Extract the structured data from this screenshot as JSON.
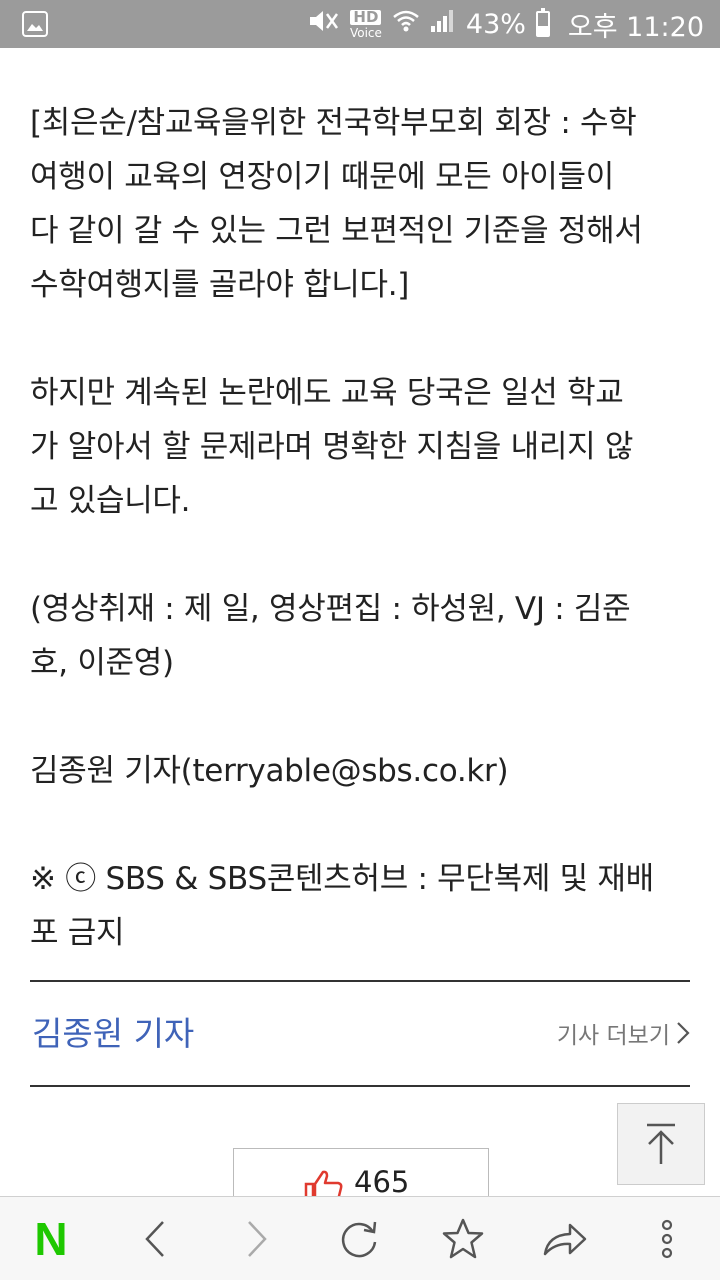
{
  "status_bar": {
    "hd_label": "HD",
    "voice_label": "Voice",
    "battery_percent": "43%",
    "battery_level": 0.43,
    "time": "오후 11:20"
  },
  "article": {
    "paragraphs": [
      "[최은순/참교육을위한 전국학부모회 회장 : 수학\n여행이 교육의 연장이기 때문에 모든 아이들이\n다 같이 갈 수 있는 그런 보편적인 기준을 정해서\n수학여행지를 골라야 합니다.]",
      "하지만 계속된 논란에도 교육 당국은 일선 학교\n가 알아서 할 문제라며 명확한 지침을 내리지 않\n고 있습니다.",
      "(영상취재 : 제 일, 영상편집 : 하성원, VJ : 김준\n호, 이준영)",
      "김종원 기자(terryable@sbs.co.kr)",
      "※ ⓒ SBS & SBS콘텐츠허브 : 무단복제 및 재배\n포 금지"
    ]
  },
  "reporter": {
    "name": "김종원 기자",
    "more_link": "기사 더보기"
  },
  "like": {
    "count": "465"
  },
  "toolbar": {
    "home_label": "N"
  },
  "colors": {
    "status_bar_bg": "#9b9b9b",
    "reporter_link": "#3f63b8",
    "naver_green": "#1ec800",
    "like_red": "#e03a2f"
  }
}
